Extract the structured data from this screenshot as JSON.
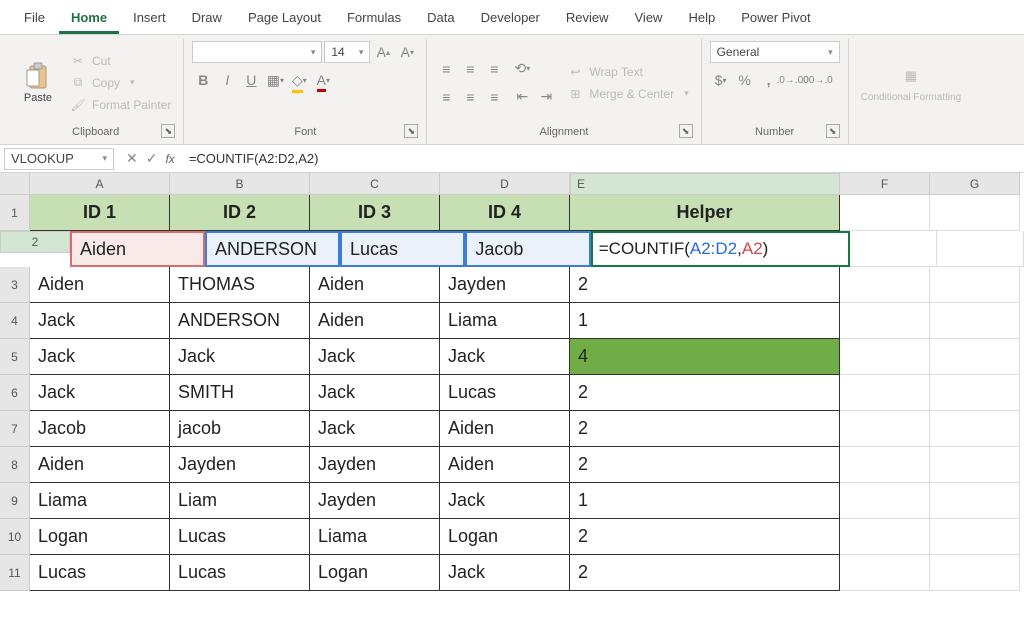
{
  "tabs": [
    "File",
    "Home",
    "Insert",
    "Draw",
    "Page Layout",
    "Formulas",
    "Data",
    "Developer",
    "Review",
    "View",
    "Help",
    "Power Pivot"
  ],
  "active_tab": "Home",
  "clipboard": {
    "paste": "Paste",
    "cut": "Cut",
    "copy": "Copy",
    "fp": "Format Painter",
    "label": "Clipboard"
  },
  "font": {
    "family": "",
    "size": "14",
    "label": "Font",
    "bold": "B",
    "italic": "I",
    "underline": "U"
  },
  "alignment": {
    "wrap": "Wrap Text",
    "merge": "Merge & Center",
    "label": "Alignment"
  },
  "number": {
    "format": "General",
    "label": "Number"
  },
  "cond": {
    "label": "Conditional Formatting"
  },
  "fbar": {
    "name": "VLOOKUP",
    "formula": "=COUNTIF(A2:D2,A2)"
  },
  "cols": [
    "A",
    "B",
    "C",
    "D",
    "E",
    "F",
    "G"
  ],
  "colw": [
    "wA",
    "wB",
    "wC",
    "wD",
    "wE",
    "wF",
    "wG"
  ],
  "rows": [
    {
      "n": "1",
      "hdr": true,
      "c": [
        "ID 1",
        "ID 2",
        "ID 3",
        "ID 4",
        "Helper"
      ]
    },
    {
      "n": "2",
      "edit": true,
      "c": [
        "Aiden",
        "ANDERSON",
        "Lucas",
        "Jacob",
        "=COUNTIF(A2:D2,A2)"
      ]
    },
    {
      "n": "3",
      "c": [
        "Aiden",
        "THOMAS",
        "Aiden",
        "Jayden",
        "2"
      ]
    },
    {
      "n": "4",
      "c": [
        "Jack",
        "ANDERSON",
        "Aiden",
        "Liama",
        "1"
      ]
    },
    {
      "n": "5",
      "hiE": true,
      "c": [
        "Jack",
        "Jack",
        "Jack",
        "Jack",
        "4"
      ]
    },
    {
      "n": "6",
      "c": [
        "Jack",
        "SMITH",
        "Jack",
        "Lucas",
        "2"
      ]
    },
    {
      "n": "7",
      "c": [
        "Jacob",
        "jacob",
        "Jack",
        "Aiden",
        "2"
      ]
    },
    {
      "n": "8",
      "c": [
        "Aiden",
        "Jayden",
        "Jayden",
        "Aiden",
        "2"
      ]
    },
    {
      "n": "9",
      "c": [
        "Liama",
        "Liam",
        "Jayden",
        "Jack",
        "1"
      ]
    },
    {
      "n": "10",
      "c": [
        "Logan",
        "Lucas",
        "Liama",
        "Logan",
        "2"
      ]
    },
    {
      "n": "11",
      "c": [
        "Lucas",
        "Lucas",
        "Logan",
        "Jack",
        "2"
      ]
    }
  ],
  "formula_tokens": {
    "pref": "=COUNTIF(",
    "range": "A2:D2",
    "comma": ",",
    "crit": "A2",
    "suf": ")"
  },
  "chart_data": {
    "type": "table",
    "title": "COUNTIF helper column",
    "columns": [
      "ID 1",
      "ID 2",
      "ID 3",
      "ID 4",
      "Helper"
    ],
    "rows": [
      [
        "Aiden",
        "ANDERSON",
        "Lucas",
        "Jacob",
        "=COUNTIF(A2:D2,A2)"
      ],
      [
        "Aiden",
        "THOMAS",
        "Aiden",
        "Jayden",
        2
      ],
      [
        "Jack",
        "ANDERSON",
        "Aiden",
        "Liama",
        1
      ],
      [
        "Jack",
        "Jack",
        "Jack",
        "Jack",
        4
      ],
      [
        "Jack",
        "SMITH",
        "Jack",
        "Lucas",
        2
      ],
      [
        "Jacob",
        "jacob",
        "Jack",
        "Aiden",
        2
      ],
      [
        "Aiden",
        "Jayden",
        "Jayden",
        "Aiden",
        2
      ],
      [
        "Liama",
        "Liam",
        "Jayden",
        "Jack",
        1
      ],
      [
        "Logan",
        "Lucas",
        "Liama",
        "Logan",
        2
      ],
      [
        "Lucas",
        "Lucas",
        "Logan",
        "Jack",
        2
      ]
    ]
  }
}
